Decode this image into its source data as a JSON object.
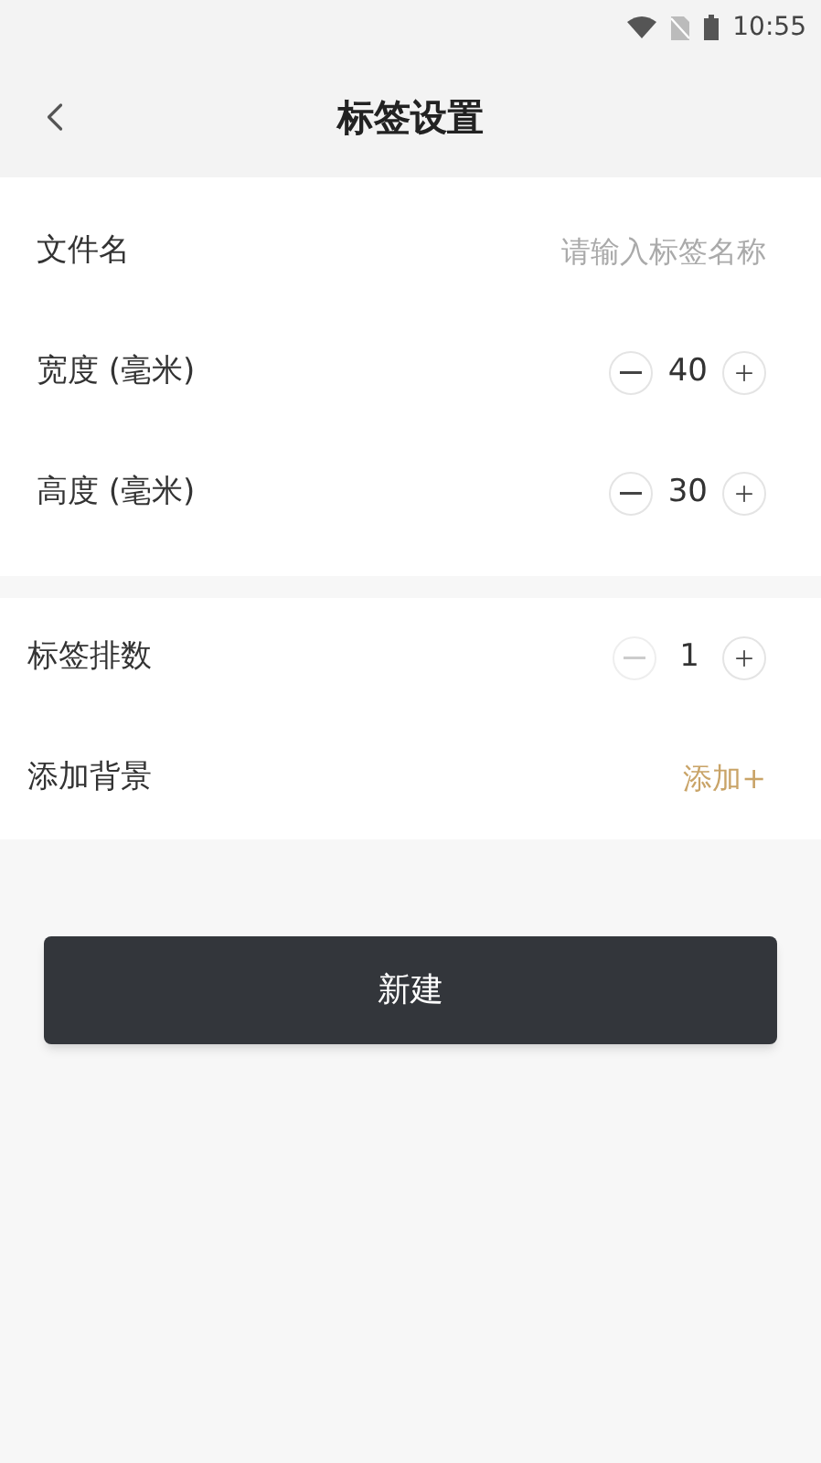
{
  "status_bar": {
    "time": "10:55"
  },
  "header": {
    "title": "标签设置"
  },
  "section_1": [
    {
      "kind": "input",
      "label": "文件名",
      "placeholder": "请输入标签名称"
    },
    {
      "kind": "stepper",
      "label": "宽度 (毫米)",
      "value": "40",
      "minus_disabled": false
    },
    {
      "kind": "stepper",
      "label": "高度 (毫米)",
      "value": "30",
      "minus_disabled": false
    }
  ],
  "section_2": [
    {
      "kind": "stepper",
      "label": "标签排数",
      "value": "1",
      "minus_disabled": true
    },
    {
      "kind": "link",
      "label": "添加背景",
      "action": "添加+"
    }
  ],
  "button": {
    "label": "新建"
  }
}
